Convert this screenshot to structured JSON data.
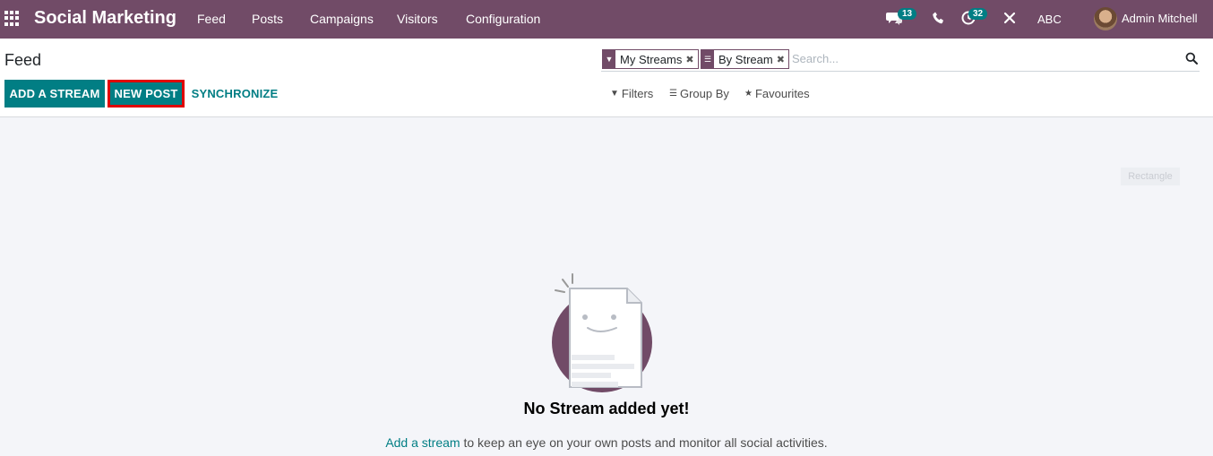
{
  "navbar": {
    "brand": "Social Marketing",
    "menu": [
      "Feed",
      "Posts",
      "Campaigns",
      "Visitors",
      "Configuration"
    ],
    "messages_count": "13",
    "activities_count": "32",
    "company": "ABC",
    "user": "Admin Mitchell"
  },
  "control": {
    "title": "Feed",
    "add_stream": "ADD A STREAM",
    "new_post": "NEW POST",
    "synchronize": "SYNCHRONIZE",
    "facets": [
      "My Streams",
      "By Stream"
    ],
    "search_placeholder": "Search...",
    "filters": "Filters",
    "group_by": "Group By",
    "favourites": "Favourites"
  },
  "overlay": {
    "rectangle_label": "Rectangle"
  },
  "empty": {
    "title": "No Stream added yet!",
    "link": "Add a stream",
    "text": " to keep an eye on your own posts and monitor all social activities."
  },
  "colors": {
    "brand": "#714b67",
    "accent": "#017e84",
    "highlight": "#e00000"
  }
}
